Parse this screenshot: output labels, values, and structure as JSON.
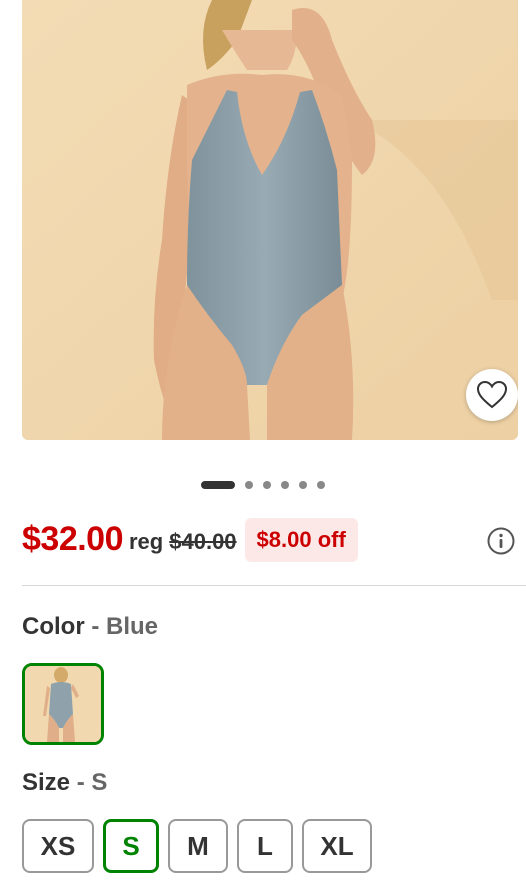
{
  "product": {
    "image_alt": "Blue one-piece swimsuit",
    "favorite_icon": "heart-outline-icon",
    "carousel": {
      "total": 6,
      "active": 1
    }
  },
  "pricing": {
    "current_price": "$32.00",
    "reg_label": "reg",
    "reg_price": "$40.00",
    "discount": "$8.00 off",
    "info_icon": "info-circle-icon"
  },
  "color": {
    "label": "Color",
    "separator": " - ",
    "selected": "Blue",
    "swatches": [
      {
        "name": "Blue",
        "selected": true
      }
    ]
  },
  "size": {
    "label": "Size",
    "separator": " - ",
    "selected": "S",
    "options": [
      {
        "label": "XS",
        "selected": false
      },
      {
        "label": "S",
        "selected": true
      },
      {
        "label": "M",
        "selected": false
      },
      {
        "label": "L",
        "selected": false
      },
      {
        "label": "XL",
        "selected": false
      }
    ]
  },
  "colors": {
    "price_red": "#cc0000",
    "discount_bg": "#fde8e8",
    "selected_green": "#008300",
    "text_dark": "#333333"
  }
}
